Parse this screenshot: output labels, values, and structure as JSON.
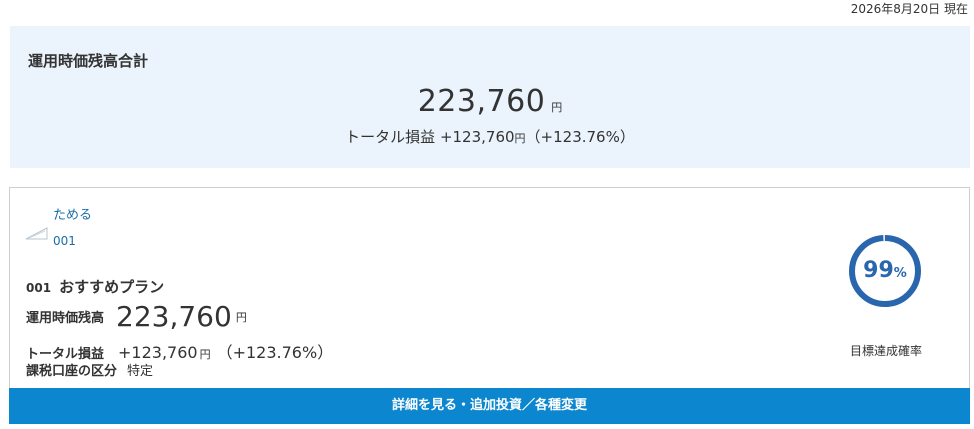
{
  "as_of": "2026年8月20日 現在",
  "summary": {
    "title": "運用時価残高合計",
    "amount": "223,760",
    "amount_unit": "円",
    "pl_label": "トータル損益",
    "pl_value": "+123,760",
    "pl_unit": "円",
    "pl_percent": "（+123.76%）"
  },
  "goal": {
    "name": "ためる",
    "id": "001"
  },
  "plan": {
    "id": "001",
    "name": "おすすめプラン",
    "balance_label": "運用時価残高",
    "balance": "223,760",
    "balance_unit": "円",
    "pl_label": "トータル損益",
    "pl_value": "+123,760",
    "pl_unit": "円",
    "pl_percent": "（+123.76%）",
    "tax_label": "課税口座の区分",
    "tax_value": "特定"
  },
  "achievement": {
    "rate": "99",
    "rate_value": 0.99,
    "percent_sign": "%",
    "label": "目標達成確率",
    "color": "#2a66ad",
    "track_color": "#ffffff"
  },
  "detail_button": {
    "label": "詳細を見る・追加投資／各種変更",
    "color": "#0b86cf"
  }
}
